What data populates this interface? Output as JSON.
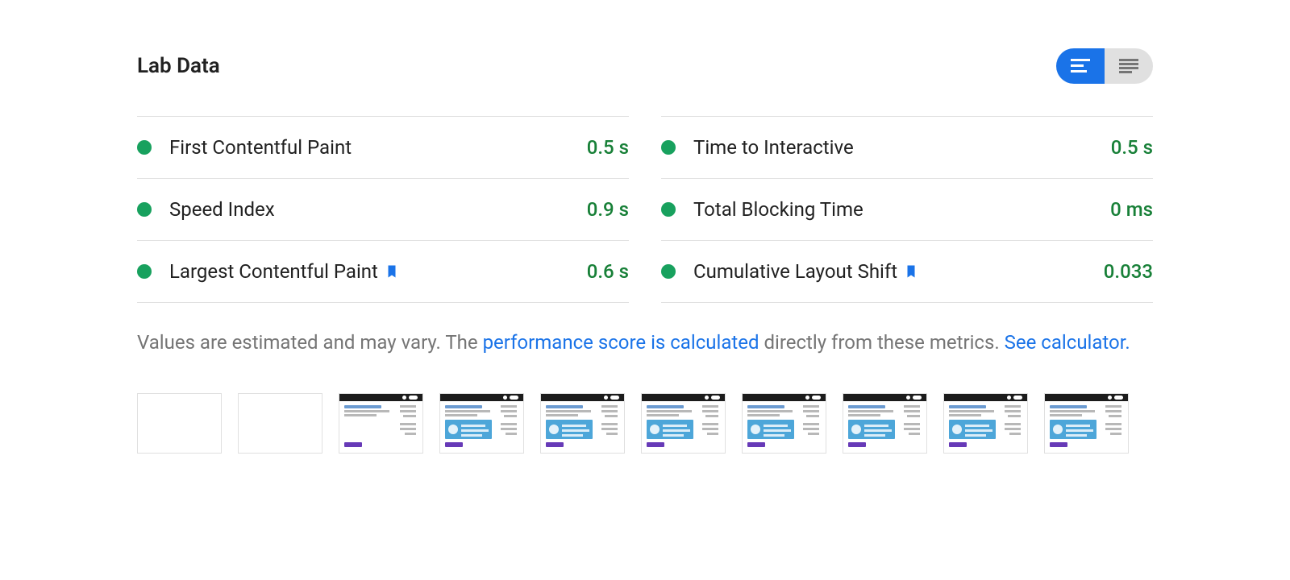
{
  "header": {
    "title": "Lab Data"
  },
  "metrics": [
    {
      "label": "First Contentful Paint",
      "value": "0.5 s",
      "status": "pass",
      "bookmark": false
    },
    {
      "label": "Time to Interactive",
      "value": "0.5 s",
      "status": "pass",
      "bookmark": false
    },
    {
      "label": "Speed Index",
      "value": "0.9 s",
      "status": "pass",
      "bookmark": false
    },
    {
      "label": "Total Blocking Time",
      "value": "0 ms",
      "status": "pass",
      "bookmark": false
    },
    {
      "label": "Largest Contentful Paint",
      "value": "0.6 s",
      "status": "pass",
      "bookmark": true
    },
    {
      "label": "Cumulative Layout Shift",
      "value": "0.033",
      "status": "pass",
      "bookmark": true
    }
  ],
  "disclaimer": {
    "prefix": "Values are estimated and may vary. The ",
    "link1": "performance score is calculated",
    "middle": " directly from these metrics. ",
    "link2": "See calculator."
  },
  "toggle": {
    "state": "compact",
    "option_compact_icon": "short-text-icon",
    "option_expanded_icon": "paragraph-icon"
  },
  "filmstrip": {
    "count": 10,
    "frames": [
      {
        "stage": "blank"
      },
      {
        "stage": "blank"
      },
      {
        "stage": "partial"
      },
      {
        "stage": "full"
      },
      {
        "stage": "full"
      },
      {
        "stage": "full"
      },
      {
        "stage": "full"
      },
      {
        "stage": "full"
      },
      {
        "stage": "full"
      },
      {
        "stage": "full"
      }
    ]
  }
}
